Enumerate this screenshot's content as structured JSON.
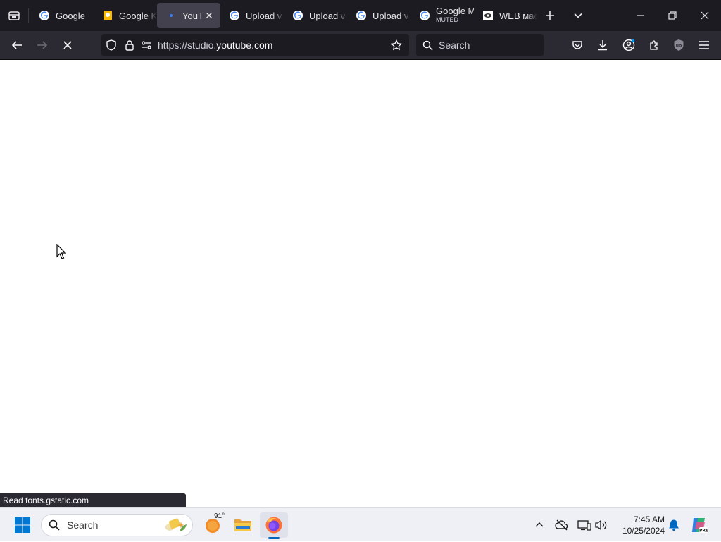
{
  "tabs": [
    {
      "title": "Google",
      "favicon": "google-icon",
      "active": false
    },
    {
      "title": "Google K",
      "favicon": "keep-icon",
      "active": false
    },
    {
      "title": "YouTube",
      "favicon": "loading-dot-icon",
      "active": true
    },
    {
      "title": "Upload v",
      "favicon": "google-icon",
      "active": false
    },
    {
      "title": "Upload v",
      "favicon": "google-icon",
      "active": false
    },
    {
      "title": "Upload v",
      "favicon": "google-icon",
      "active": false
    },
    {
      "title": "Google M",
      "subtitle": "MUTED",
      "favicon": "google-icon",
      "active": false
    },
    {
      "title": "WEB мас",
      "favicon": "web-icon",
      "active": false
    }
  ],
  "url": {
    "prefix": "https://studio.",
    "host": "youtube.com"
  },
  "search_placeholder": "Search",
  "status_text": "Read fonts.gstatic.com",
  "taskbar": {
    "search_placeholder": "Search",
    "weather_temp": "91°",
    "time": "7:45 AM",
    "date": "10/25/2024"
  },
  "colors": {
    "tabbar_bg": "#1c1b22",
    "navbar_bg": "#2b2a33",
    "active_tab": "#42414d",
    "taskbar_bg": "#eef0f5",
    "accent": "#0078d4"
  }
}
